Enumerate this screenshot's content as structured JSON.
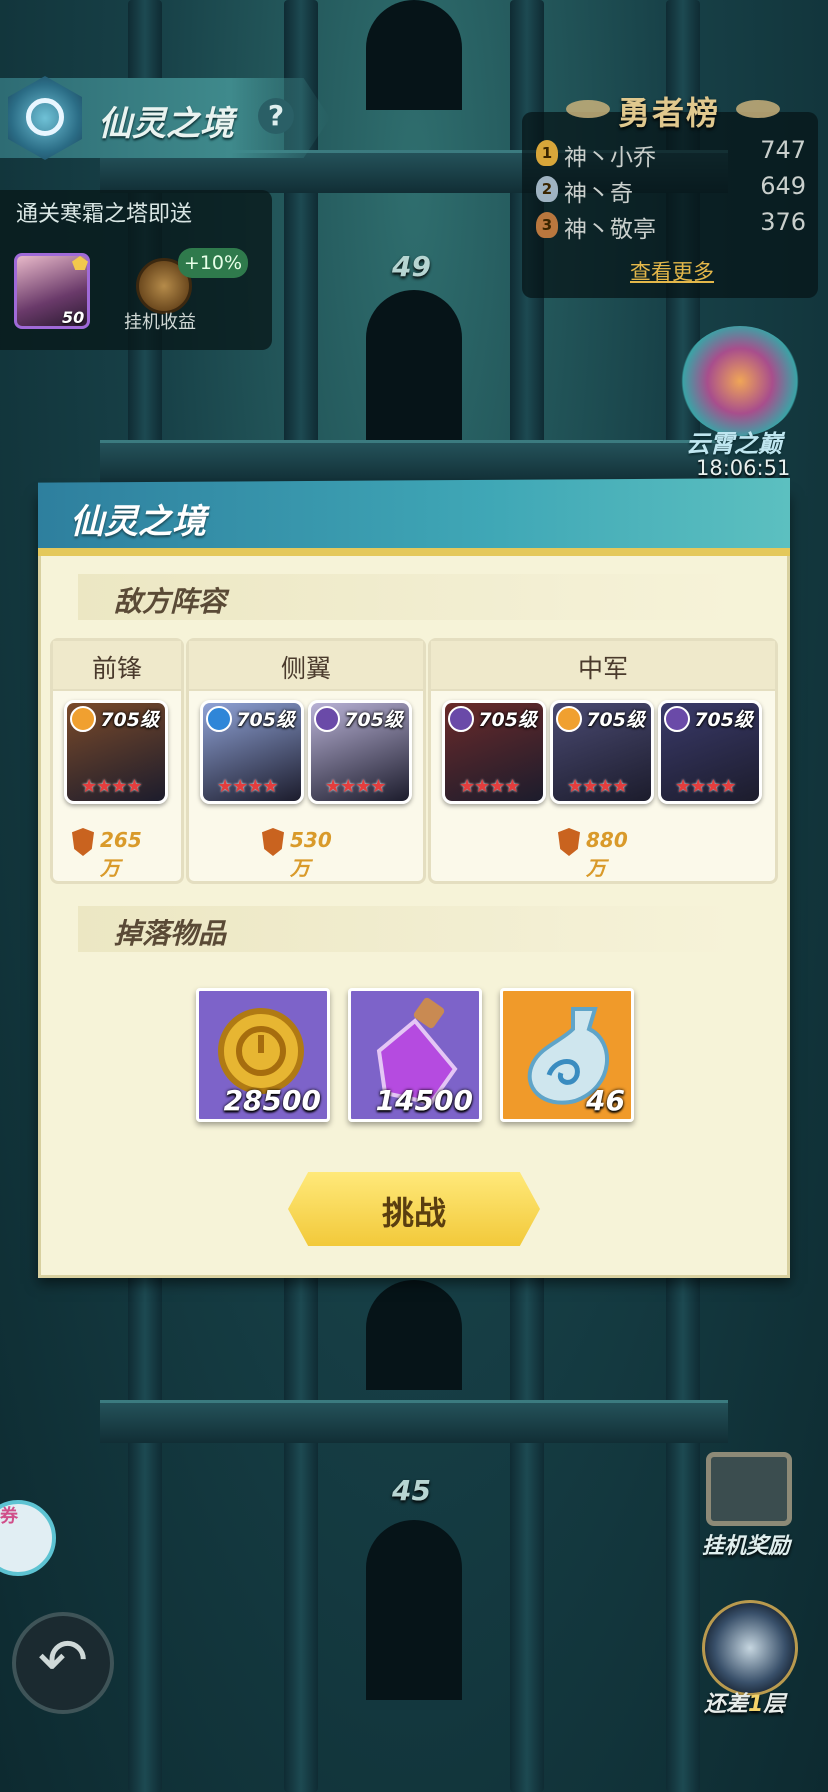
{
  "header": {
    "title": "仙灵之境",
    "help_label": "?"
  },
  "info_panel": {
    "text": "通关寒霜之塔即送",
    "hero_level": "50",
    "idle_bonus": "+10%",
    "idle_label": "挂机收益"
  },
  "leaderboard": {
    "title": "勇者榜",
    "rows": [
      {
        "rank": "1",
        "name": "神丶小乔",
        "score": "747",
        "medal_color": "#d8a63a"
      },
      {
        "rank": "2",
        "name": "神丶奇",
        "score": "649",
        "medal_color": "#9fb3c2"
      },
      {
        "rank": "3",
        "name": "神丶敬亭",
        "score": "376",
        "medal_color": "#b9773e"
      }
    ],
    "more_label": "查看更多"
  },
  "tower": {
    "floor_upper": "49",
    "floor_lower": "45"
  },
  "side": {
    "event_name": "云霄之巅",
    "event_time": "18:06:51",
    "idle_reward_label": "挂机奖励",
    "remain_prefix": "还差",
    "remain_number": "1",
    "remain_suffix": "层",
    "coupon_text": "券"
  },
  "dialog": {
    "title": "仙灵之境",
    "enemy_section": "敌方阵容",
    "groups": [
      {
        "label": "前锋",
        "power": "265万"
      },
      {
        "label": "侧翼",
        "power": "530万"
      },
      {
        "label": "中军",
        "power": "880万"
      }
    ],
    "heroes": [
      {
        "level": "705级",
        "stars": "★★★★",
        "element_color": "#f0a030",
        "face": "#7a4a2a"
      },
      {
        "level": "705级",
        "stars": "★★★★",
        "element_color": "#2f86d8",
        "face": "#8fa2d6"
      },
      {
        "level": "705级",
        "stars": "★★★★",
        "element_color": "#6a4aa8",
        "face": "#b9b2d6"
      },
      {
        "level": "705级",
        "stars": "★★★★",
        "element_color": "#6a4aa8",
        "face": "#6a2a2a"
      },
      {
        "level": "705级",
        "stars": "★★★★",
        "element_color": "#f0a030",
        "face": "#4a4a72"
      },
      {
        "level": "705级",
        "stars": "★★★★",
        "element_color": "#6a4aa8",
        "face": "#3a3a6a"
      }
    ],
    "drop_section": "掉落物品",
    "drops": [
      {
        "name": "coin-icon",
        "count": "28500",
        "bg": "#7d63c9"
      },
      {
        "name": "potion-icon",
        "count": "14500",
        "bg": "#7d63c9"
      },
      {
        "name": "vase-icon",
        "count": "46",
        "bg": "#f09a2a"
      }
    ],
    "challenge_label": "挑战"
  }
}
